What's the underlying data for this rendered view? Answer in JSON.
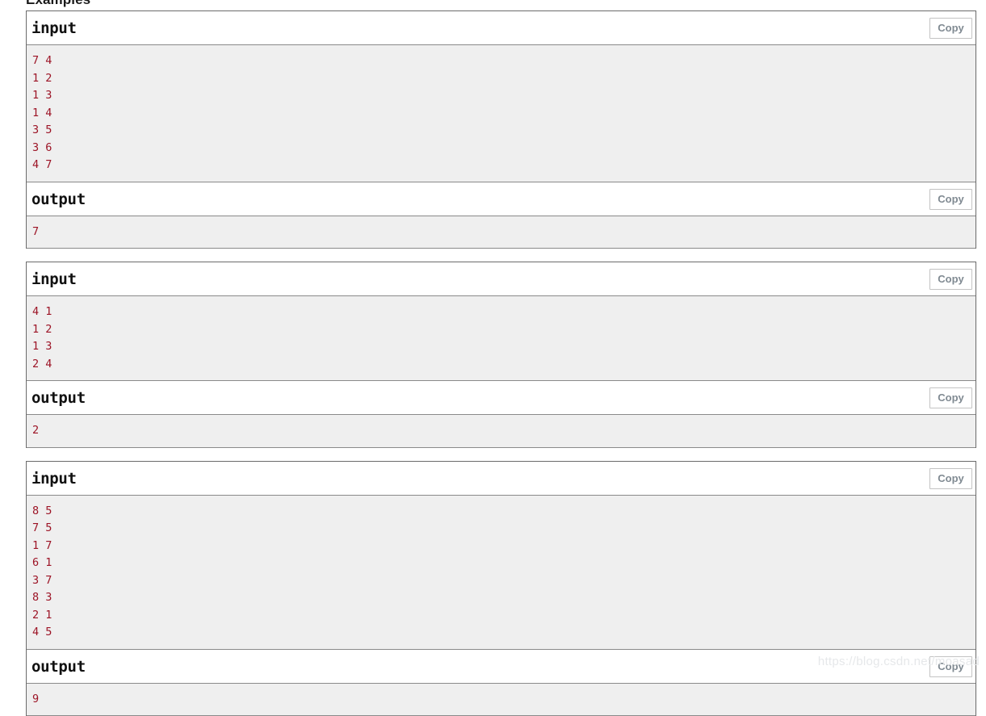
{
  "section": {
    "heading": "Examples"
  },
  "labels": {
    "input": "input",
    "output": "output",
    "copy": "Copy"
  },
  "examples": [
    {
      "input": "7 4\n1 2\n1 3\n1 4\n3 5\n3 6\n4 7",
      "output": "7"
    },
    {
      "input": "4 1\n1 2\n1 3\n2 4",
      "output": "2"
    },
    {
      "input": "8 5\n7 5\n1 7\n6 1\n3 7\n8 3\n2 1\n4 5",
      "output": "9"
    }
  ],
  "watermark": {
    "text": "https://blog.csdn.net/moasad"
  },
  "colors": {
    "data_text": "#9c1325",
    "data_background": "#efefef",
    "border": "#6b6b6b",
    "copy_text": "#808a92"
  }
}
